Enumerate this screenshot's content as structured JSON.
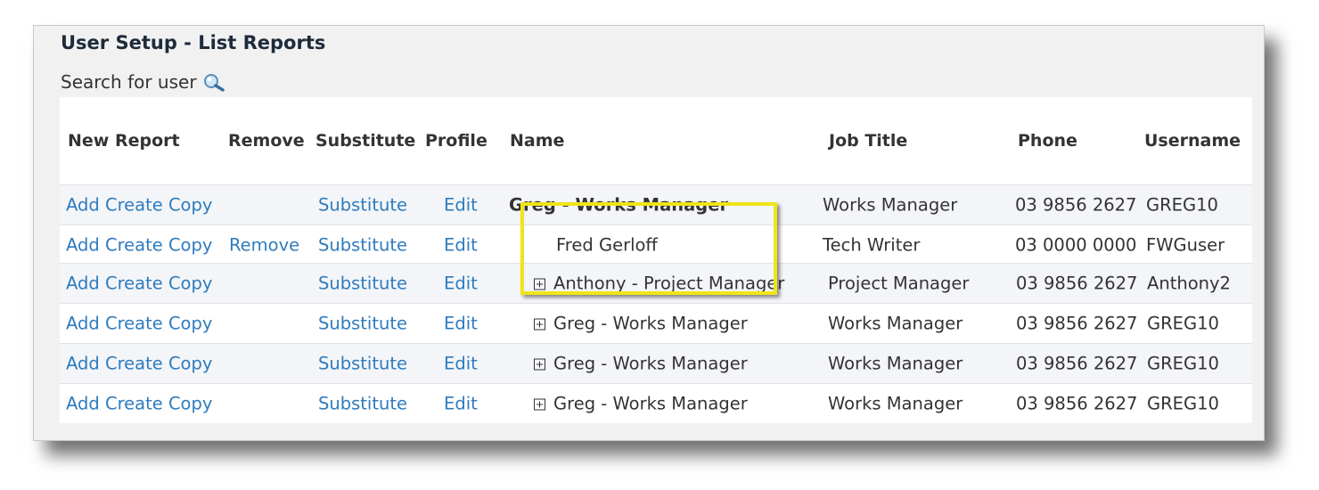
{
  "page": {
    "title": "User Setup - List Reports",
    "search_label": "Search for user",
    "search_icon": "search-icon"
  },
  "table": {
    "headers": {
      "new_report": "New Report",
      "remove": "Remove",
      "substitute": "Substitute",
      "profile": "Profile",
      "name": "Name",
      "job_title": "Job Title",
      "phone": "Phone",
      "username": "Username"
    },
    "rows": [
      {
        "new_report": "Add Create Copy",
        "remove": "",
        "substitute": "Substitute",
        "profile": "Edit",
        "name": "Greg - Works Manager",
        "job_title": "Works Manager",
        "phone": "03 9856 2627",
        "username": "GREG10"
      },
      {
        "new_report": "Add Create Copy",
        "remove": "Remove",
        "substitute": "Substitute",
        "profile": "Edit",
        "name": "Fred Gerloff",
        "job_title": "Tech Writer",
        "phone": "03 0000 0000",
        "username": "FWGuser"
      },
      {
        "new_report": "Add Create Copy",
        "remove": "",
        "substitute": "Substitute",
        "profile": "Edit",
        "name": "Anthony - Project Manager",
        "job_title": "Project Manager",
        "phone": "03 9856 2627",
        "username": "Anthony2"
      },
      {
        "new_report": "Add Create Copy",
        "remove": "",
        "substitute": "Substitute",
        "profile": "Edit",
        "name": "Greg - Works Manager",
        "job_title": "Works Manager",
        "phone": "03 9856 2627",
        "username": "GREG10"
      },
      {
        "new_report": "Add Create Copy",
        "remove": "",
        "substitute": "Substitute",
        "profile": "Edit",
        "name": "Greg - Works Manager",
        "job_title": "Works Manager",
        "phone": "03 9856 2627",
        "username": "GREG10"
      },
      {
        "new_report": "Add Create Copy",
        "remove": "",
        "substitute": "Substitute",
        "profile": "Edit",
        "name": "Greg - Works Manager",
        "job_title": "Works Manager",
        "phone": "03 9856 2627",
        "username": "GREG10"
      }
    ]
  },
  "colors": {
    "link": "#2e7bbf",
    "highlight": "#f0e519",
    "text": "#333333"
  }
}
